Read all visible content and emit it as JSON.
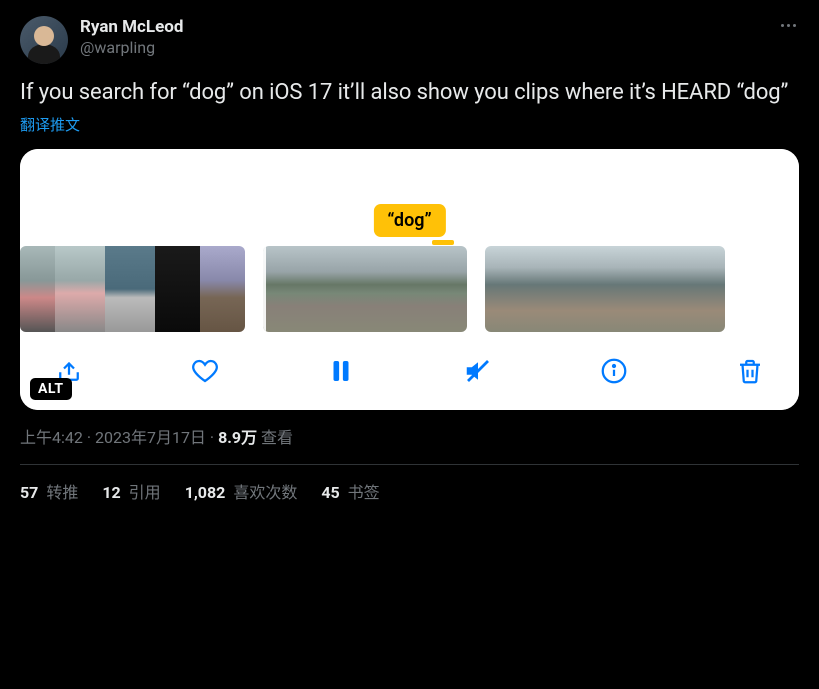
{
  "author": {
    "display_name": "Ryan McLeod",
    "handle": "@warpling"
  },
  "tweet_text": "If you search for “dog” on iOS 17 it’ll also show you clips where it’s HEARD “dog”",
  "translate_label": "翻译推文",
  "media": {
    "dog_label": "“dog”",
    "alt_badge": "ALT"
  },
  "meta": {
    "time": "上午4:42",
    "separator": " · ",
    "date": "2023年7月17日",
    "views_count": "8.9万",
    "views_label": " 查看"
  },
  "stats": {
    "retweets": {
      "count": "57",
      "label": " 转推"
    },
    "quotes": {
      "count": "12",
      "label": " 引用"
    },
    "likes": {
      "count": "1,082",
      "label": " 喜欢次数"
    },
    "bookmarks": {
      "count": "45",
      "label": " 书签"
    }
  }
}
